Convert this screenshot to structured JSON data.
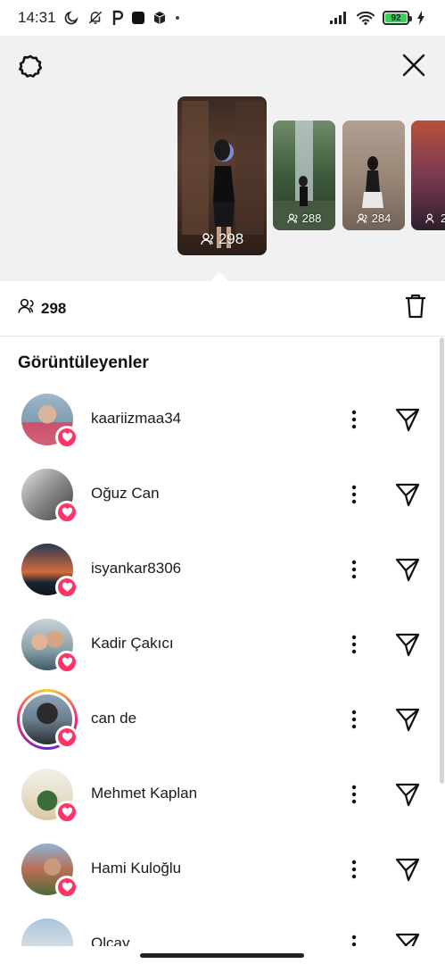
{
  "status_bar": {
    "time": "14:31",
    "battery": "92",
    "icons": [
      "moon-icon",
      "muted-icon",
      "p-icon",
      "app-icon",
      "box-icon",
      "dot-icon",
      "signal-icon",
      "wifi-icon",
      "battery-icon",
      "charging-icon"
    ]
  },
  "top": {
    "settings_icon": "gear-icon",
    "close_icon": "close-icon",
    "stories": [
      {
        "count": "298"
      },
      {
        "count": "288"
      },
      {
        "count": "284"
      },
      {
        "count": "2"
      }
    ]
  },
  "summary": {
    "viewers_count": "298",
    "delete_icon": "trash-icon"
  },
  "viewers_title": "Görüntüleyenler",
  "viewers": [
    {
      "username": "kaariizmaa34",
      "liked": true,
      "story_ring": false
    },
    {
      "username": "Oğuz Can",
      "liked": true,
      "story_ring": false
    },
    {
      "username": "isyankar8306",
      "liked": true,
      "story_ring": false
    },
    {
      "username": "Kadir Çakıcı",
      "liked": true,
      "story_ring": false
    },
    {
      "username": "can de",
      "liked": true,
      "story_ring": true
    },
    {
      "username": "Mehmet Kaplan",
      "liked": true,
      "story_ring": false
    },
    {
      "username": "Hami Kuloğlu",
      "liked": true,
      "story_ring": false
    },
    {
      "username": "Olcay",
      "liked": false,
      "story_ring": false
    }
  ],
  "colors": {
    "heart_badge": "#ff3366",
    "top_background": "#f1f1f1",
    "battery_fill": "#39d353"
  }
}
